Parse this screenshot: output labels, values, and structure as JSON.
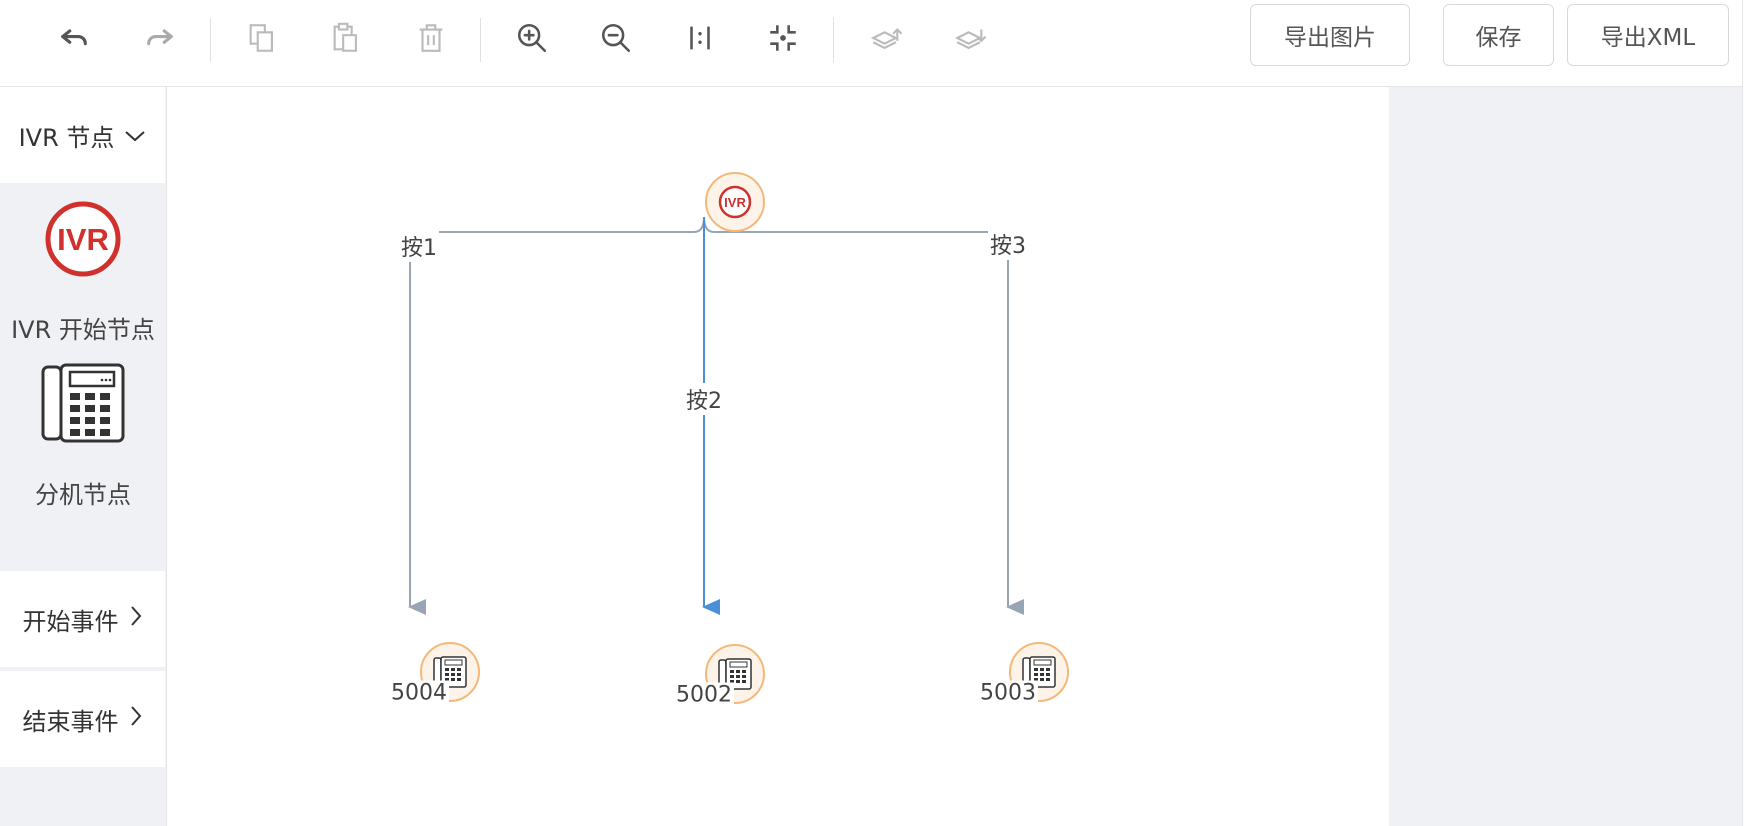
{
  "toolbar": {
    "icons": [
      "undo-icon",
      "redo-icon",
      "copy-icon",
      "paste-icon",
      "delete-icon",
      "zoom-in-icon",
      "zoom-out-icon",
      "actual-size-icon",
      "fit-icon",
      "bring-to-front-icon",
      "send-to-back-icon"
    ],
    "export_image_label": "导出图片",
    "save_label": "保存",
    "export_xml_label": "导出XML"
  },
  "sidebar": {
    "ivr_section_label": "IVR 节点",
    "ivr_start_logo_text": "IVR",
    "ivr_start_label": "IVR 开始节点",
    "extension_label": "分机节点",
    "start_events_label": "开始事件",
    "end_events_label": "结束事件"
  },
  "diagram": {
    "root_node_text": "IVR",
    "edges": [
      {
        "label": "按1",
        "target": "5004"
      },
      {
        "label": "按2",
        "target": "5002"
      },
      {
        "label": "按3",
        "target": "5003"
      }
    ],
    "nodes": [
      "5004",
      "5002",
      "5003"
    ]
  },
  "colors": {
    "accent_red": "#d0312d",
    "node_border": "#f4b87a",
    "node_fill": "#fdf3e8",
    "edge_gray": "#9aa5b4",
    "edge_selected": "#4a90d9"
  }
}
